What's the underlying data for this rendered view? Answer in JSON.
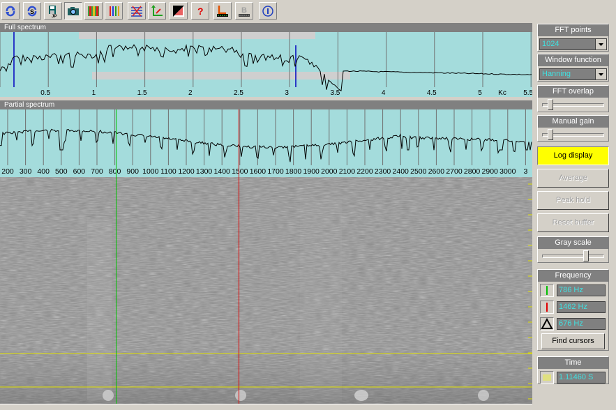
{
  "panels": {
    "full_title": "Full spectrum",
    "partial_title": "Partial spectrum"
  },
  "full_axis": {
    "ticks": [
      "0.5",
      "1",
      "1.5",
      "2",
      "2.5",
      "3",
      "3.5",
      "4",
      "4.5",
      "5",
      "5.5"
    ],
    "unit": "Kc"
  },
  "partial_axis": {
    "ticks": [
      "200",
      "300",
      "400",
      "500",
      "600",
      "700",
      "800",
      "900",
      "1000",
      "1100",
      "1200",
      "1300",
      "1400",
      "1500",
      "1600",
      "1700",
      "1800",
      "1900",
      "2000",
      "2100",
      "2200",
      "2300",
      "2400",
      "2500",
      "2600",
      "2700",
      "2800",
      "2900",
      "3000",
      "3"
    ]
  },
  "side": {
    "fft_points_label": "FFT points",
    "fft_points_value": "1024",
    "window_function_label": "Window function",
    "window_function_value": "Hanning",
    "fft_overlap_label": "FFT overlap",
    "fft_overlap_level": 0.1,
    "manual_gain_label": "Manual gain",
    "manual_gain_level": 0.1,
    "log_display": "Log display",
    "average": "Average",
    "peak_hold": "Peak hold",
    "reset_buffer": "Reset buffer",
    "gray_scale_label": "Gray scale",
    "gray_scale_level": 0.75,
    "frequency_label": "Frequency",
    "cursor1_value": "786 Hz",
    "cursor2_value": "1462 Hz",
    "delta_value": "676 Hz",
    "find_cursors": "Find cursors",
    "time_label": "Time",
    "time_value": "1.11460 S"
  },
  "colors": {
    "spectrum_bg": "#a4dcdc",
    "cursor_green": "#00c000",
    "cursor_red": "#e00000",
    "marker_blue": "#0000c0",
    "yellow_line": "#e0e000",
    "value_text": "#40e0e0"
  },
  "cursors": {
    "green_hz": 786,
    "red_hz": 1462
  }
}
